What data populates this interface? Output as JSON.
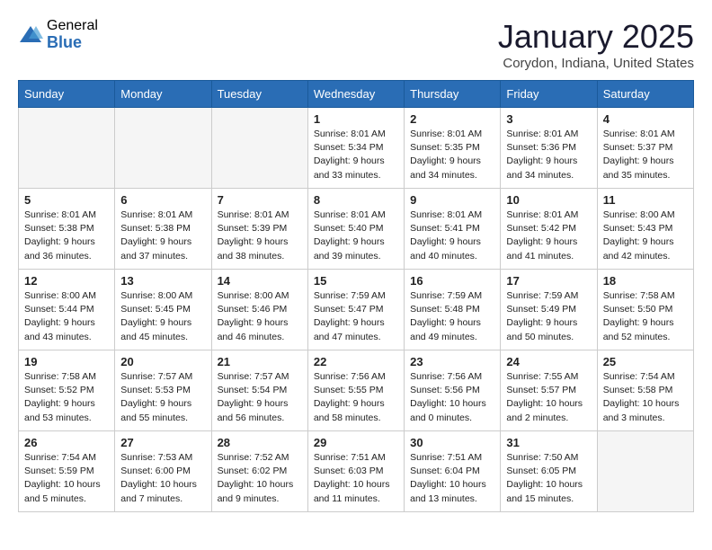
{
  "header": {
    "logo_general": "General",
    "logo_blue": "Blue",
    "month_title": "January 2025",
    "location": "Corydon, Indiana, United States"
  },
  "days_of_week": [
    "Sunday",
    "Monday",
    "Tuesday",
    "Wednesday",
    "Thursday",
    "Friday",
    "Saturday"
  ],
  "weeks": [
    [
      {
        "day": "",
        "empty": true
      },
      {
        "day": "",
        "empty": true
      },
      {
        "day": "",
        "empty": true
      },
      {
        "day": "1",
        "sunrise": "8:01 AM",
        "sunset": "5:34 PM",
        "daylight": "9 hours and 33 minutes."
      },
      {
        "day": "2",
        "sunrise": "8:01 AM",
        "sunset": "5:35 PM",
        "daylight": "9 hours and 34 minutes."
      },
      {
        "day": "3",
        "sunrise": "8:01 AM",
        "sunset": "5:36 PM",
        "daylight": "9 hours and 34 minutes."
      },
      {
        "day": "4",
        "sunrise": "8:01 AM",
        "sunset": "5:37 PM",
        "daylight": "9 hours and 35 minutes."
      }
    ],
    [
      {
        "day": "5",
        "sunrise": "8:01 AM",
        "sunset": "5:38 PM",
        "daylight": "9 hours and 36 minutes."
      },
      {
        "day": "6",
        "sunrise": "8:01 AM",
        "sunset": "5:38 PM",
        "daylight": "9 hours and 37 minutes."
      },
      {
        "day": "7",
        "sunrise": "8:01 AM",
        "sunset": "5:39 PM",
        "daylight": "9 hours and 38 minutes."
      },
      {
        "day": "8",
        "sunrise": "8:01 AM",
        "sunset": "5:40 PM",
        "daylight": "9 hours and 39 minutes."
      },
      {
        "day": "9",
        "sunrise": "8:01 AM",
        "sunset": "5:41 PM",
        "daylight": "9 hours and 40 minutes."
      },
      {
        "day": "10",
        "sunrise": "8:01 AM",
        "sunset": "5:42 PM",
        "daylight": "9 hours and 41 minutes."
      },
      {
        "day": "11",
        "sunrise": "8:00 AM",
        "sunset": "5:43 PM",
        "daylight": "9 hours and 42 minutes."
      }
    ],
    [
      {
        "day": "12",
        "sunrise": "8:00 AM",
        "sunset": "5:44 PM",
        "daylight": "9 hours and 43 minutes."
      },
      {
        "day": "13",
        "sunrise": "8:00 AM",
        "sunset": "5:45 PM",
        "daylight": "9 hours and 45 minutes."
      },
      {
        "day": "14",
        "sunrise": "8:00 AM",
        "sunset": "5:46 PM",
        "daylight": "9 hours and 46 minutes."
      },
      {
        "day": "15",
        "sunrise": "7:59 AM",
        "sunset": "5:47 PM",
        "daylight": "9 hours and 47 minutes."
      },
      {
        "day": "16",
        "sunrise": "7:59 AM",
        "sunset": "5:48 PM",
        "daylight": "9 hours and 49 minutes."
      },
      {
        "day": "17",
        "sunrise": "7:59 AM",
        "sunset": "5:49 PM",
        "daylight": "9 hours and 50 minutes."
      },
      {
        "day": "18",
        "sunrise": "7:58 AM",
        "sunset": "5:50 PM",
        "daylight": "9 hours and 52 minutes."
      }
    ],
    [
      {
        "day": "19",
        "sunrise": "7:58 AM",
        "sunset": "5:52 PM",
        "daylight": "9 hours and 53 minutes."
      },
      {
        "day": "20",
        "sunrise": "7:57 AM",
        "sunset": "5:53 PM",
        "daylight": "9 hours and 55 minutes."
      },
      {
        "day": "21",
        "sunrise": "7:57 AM",
        "sunset": "5:54 PM",
        "daylight": "9 hours and 56 minutes."
      },
      {
        "day": "22",
        "sunrise": "7:56 AM",
        "sunset": "5:55 PM",
        "daylight": "9 hours and 58 minutes."
      },
      {
        "day": "23",
        "sunrise": "7:56 AM",
        "sunset": "5:56 PM",
        "daylight": "10 hours and 0 minutes."
      },
      {
        "day": "24",
        "sunrise": "7:55 AM",
        "sunset": "5:57 PM",
        "daylight": "10 hours and 2 minutes."
      },
      {
        "day": "25",
        "sunrise": "7:54 AM",
        "sunset": "5:58 PM",
        "daylight": "10 hours and 3 minutes."
      }
    ],
    [
      {
        "day": "26",
        "sunrise": "7:54 AM",
        "sunset": "5:59 PM",
        "daylight": "10 hours and 5 minutes."
      },
      {
        "day": "27",
        "sunrise": "7:53 AM",
        "sunset": "6:00 PM",
        "daylight": "10 hours and 7 minutes."
      },
      {
        "day": "28",
        "sunrise": "7:52 AM",
        "sunset": "6:02 PM",
        "daylight": "10 hours and 9 minutes."
      },
      {
        "day": "29",
        "sunrise": "7:51 AM",
        "sunset": "6:03 PM",
        "daylight": "10 hours and 11 minutes."
      },
      {
        "day": "30",
        "sunrise": "7:51 AM",
        "sunset": "6:04 PM",
        "daylight": "10 hours and 13 minutes."
      },
      {
        "day": "31",
        "sunrise": "7:50 AM",
        "sunset": "6:05 PM",
        "daylight": "10 hours and 15 minutes."
      },
      {
        "day": "",
        "empty": true
      }
    ]
  ]
}
